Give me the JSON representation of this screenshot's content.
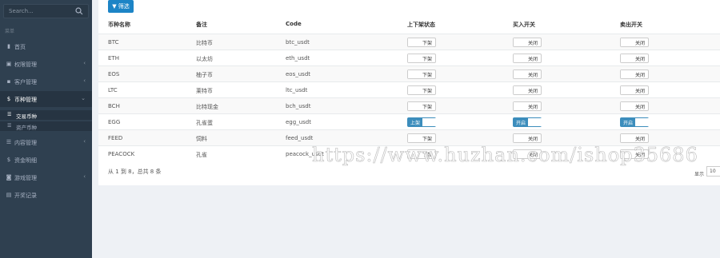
{
  "sidebar": {
    "search_placeholder": "Search...",
    "header": "菜单",
    "items": [
      {
        "label": "首页",
        "icon": "bar-chart-icon"
      },
      {
        "label": "权限管理",
        "icon": "user-icon"
      },
      {
        "label": "客户管理",
        "icon": "users-icon"
      },
      {
        "label": "币种管理",
        "icon": "dollar-icon"
      },
      {
        "label": "内容管理",
        "icon": "list-icon"
      },
      {
        "label": "资金明细",
        "icon": "dollar-icon"
      },
      {
        "label": "游戏管理",
        "icon": "gamepad-icon"
      },
      {
        "label": "开奖记录",
        "icon": "trophy-icon"
      }
    ],
    "sub_items": [
      {
        "label": "交易币种"
      },
      {
        "label": "资产币种"
      }
    ]
  },
  "toolbar": {
    "filter_label": "筛选"
  },
  "table": {
    "headers": [
      "币种名称",
      "备注",
      "Code",
      "上下架状态",
      "买入开关",
      "卖出开关"
    ],
    "rows": [
      {
        "name": "BTC",
        "note": "比特币",
        "code": "btc_usdt",
        "status": "下架",
        "buy": "关闭",
        "sell": "关闭"
      },
      {
        "name": "ETH",
        "note": "以太坊",
        "code": "eth_usdt",
        "status": "下架",
        "buy": "关闭",
        "sell": "关闭"
      },
      {
        "name": "EOS",
        "note": "柚子币",
        "code": "eos_usdt",
        "status": "下架",
        "buy": "关闭",
        "sell": "关闭"
      },
      {
        "name": "LTC",
        "note": "莱特币",
        "code": "ltc_usdt",
        "status": "下架",
        "buy": "关闭",
        "sell": "关闭"
      },
      {
        "name": "BCH",
        "note": "比特现金",
        "code": "bch_usdt",
        "status": "下架",
        "buy": "关闭",
        "sell": "关闭"
      },
      {
        "name": "EGG",
        "note": "孔雀蛋",
        "code": "egg_usdt",
        "status": "上架",
        "buy": "开启",
        "sell": "开启"
      },
      {
        "name": "FEED",
        "note": "饲料",
        "code": "feed_usdt",
        "status": "下架",
        "buy": "关闭",
        "sell": "关闭"
      },
      {
        "name": "PEACOCK",
        "note": "孔雀",
        "code": "peacock_usdt",
        "status": "下架",
        "buy": "关闭",
        "sell": "关闭"
      }
    ],
    "on_state": [
      false,
      false,
      false,
      false,
      false,
      true,
      false,
      false
    ]
  },
  "footer": {
    "summary": "从 1 到 8，总共 8 条",
    "page_size_label": "显示",
    "page_size": "10"
  },
  "watermark": "https://www.huzhan.com/ishop35686",
  "colors": {
    "sidebar": "#2f4050",
    "accent": "#1c84c6",
    "toggle_on": "#3c8dbc"
  }
}
